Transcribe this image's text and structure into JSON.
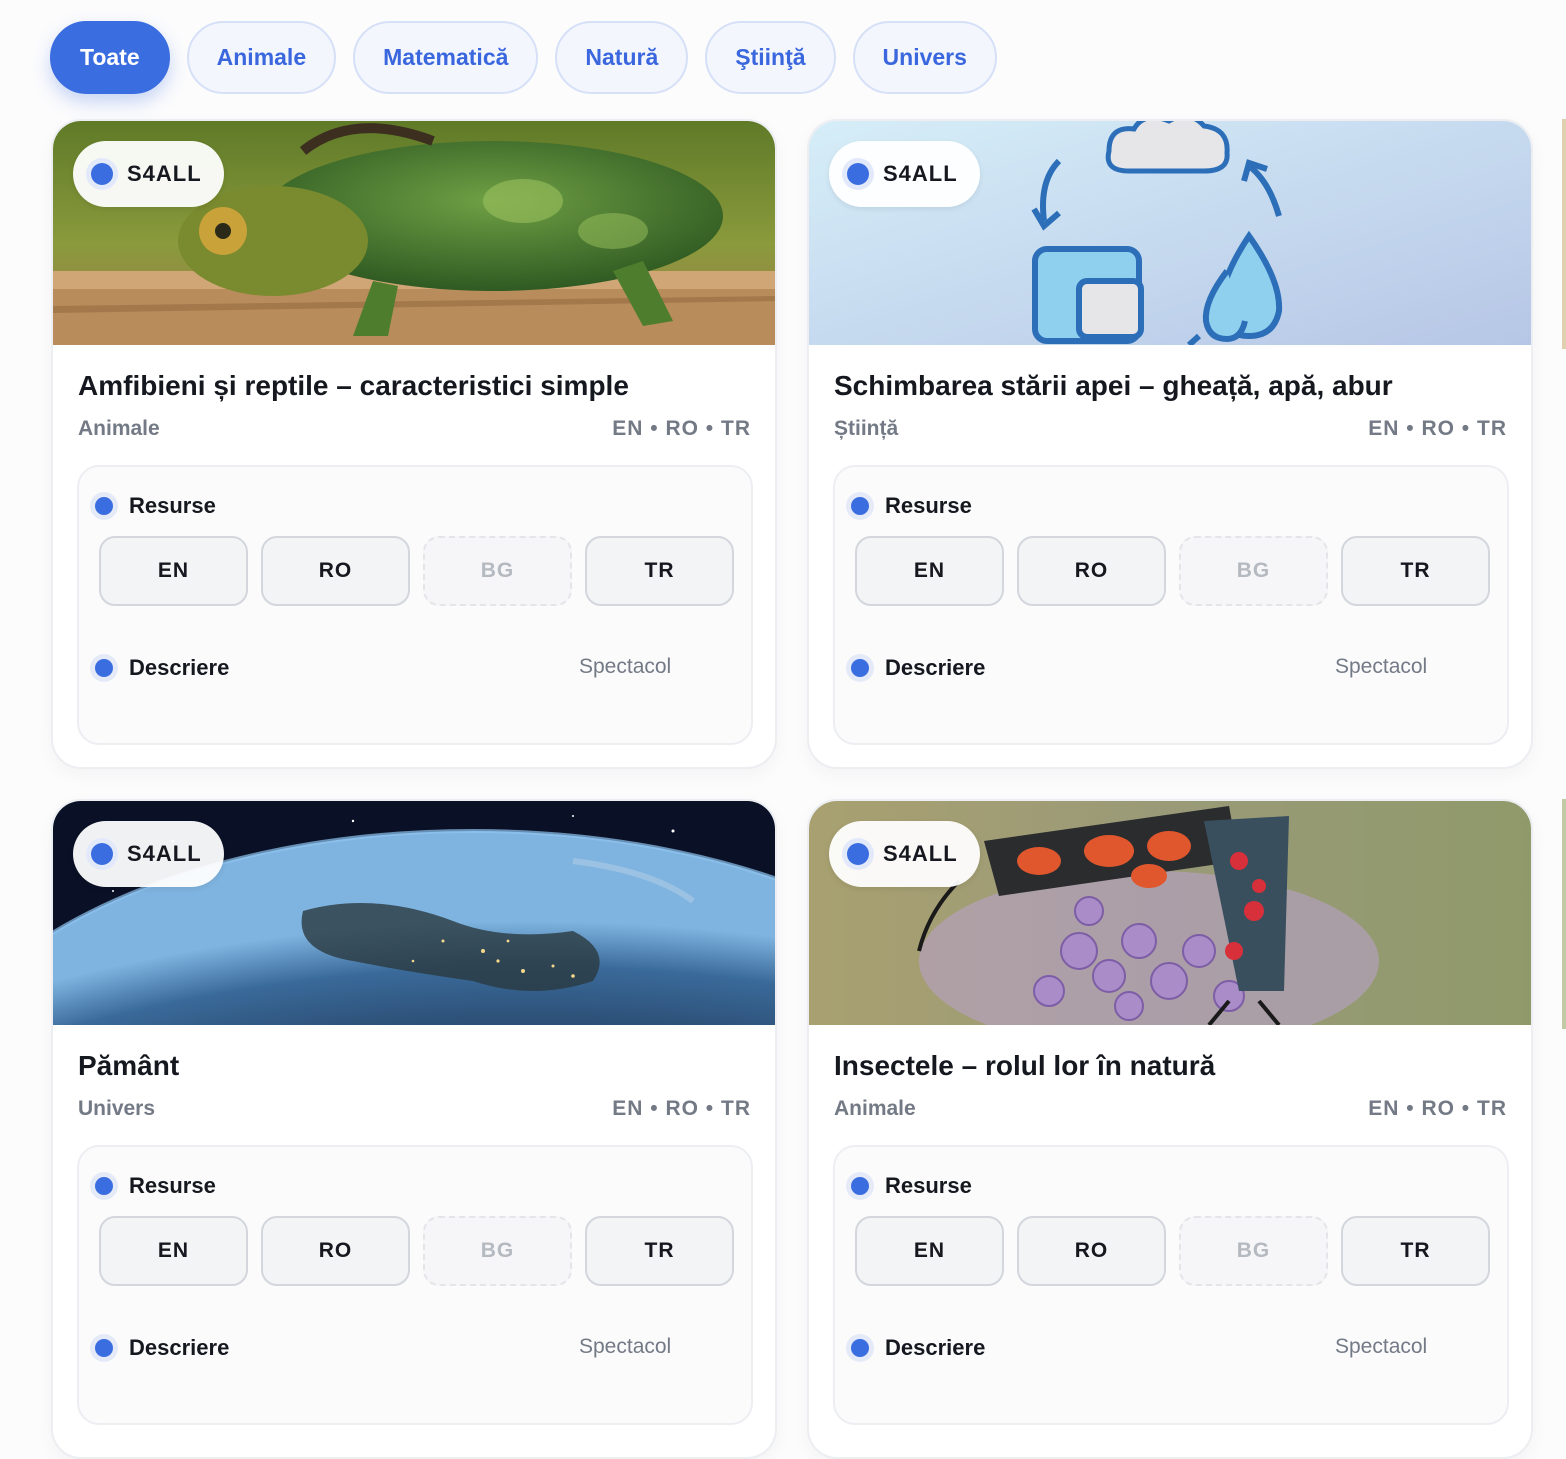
{
  "filters": [
    "Toate",
    "Animale",
    "Matematică",
    "Natură",
    "Ştiinţă",
    "Univers"
  ],
  "common": {
    "badge": "S4ALL",
    "resources_label": "Resurse",
    "description_label": "Descriere",
    "spectacol": "Spectacol",
    "lang_buttons": [
      "EN",
      "RO",
      "BG",
      "TR"
    ]
  },
  "cards": [
    {
      "title": "Amfibieni și reptile – caracteristici simple",
      "category": "Animale",
      "languages": "EN • RO • TR",
      "image": "chameleon"
    },
    {
      "title": "Schimbarea stării apei – gheață, apă, abur",
      "category": "Știință",
      "languages": "EN • RO • TR",
      "image": "water-cycle"
    },
    {
      "title": "Pământ",
      "category": "Univers",
      "languages": "EN • RO • TR",
      "image": "earth-from-space"
    },
    {
      "title": "Insectele – rolul lor în natură",
      "category": "Animale",
      "languages": "EN • RO • TR",
      "image": "moth-on-flower"
    }
  ],
  "colors": {
    "accent": "#3a6de0",
    "chip_bg": "#f3f6fd",
    "text": "#15181f",
    "muted": "#737a86"
  }
}
